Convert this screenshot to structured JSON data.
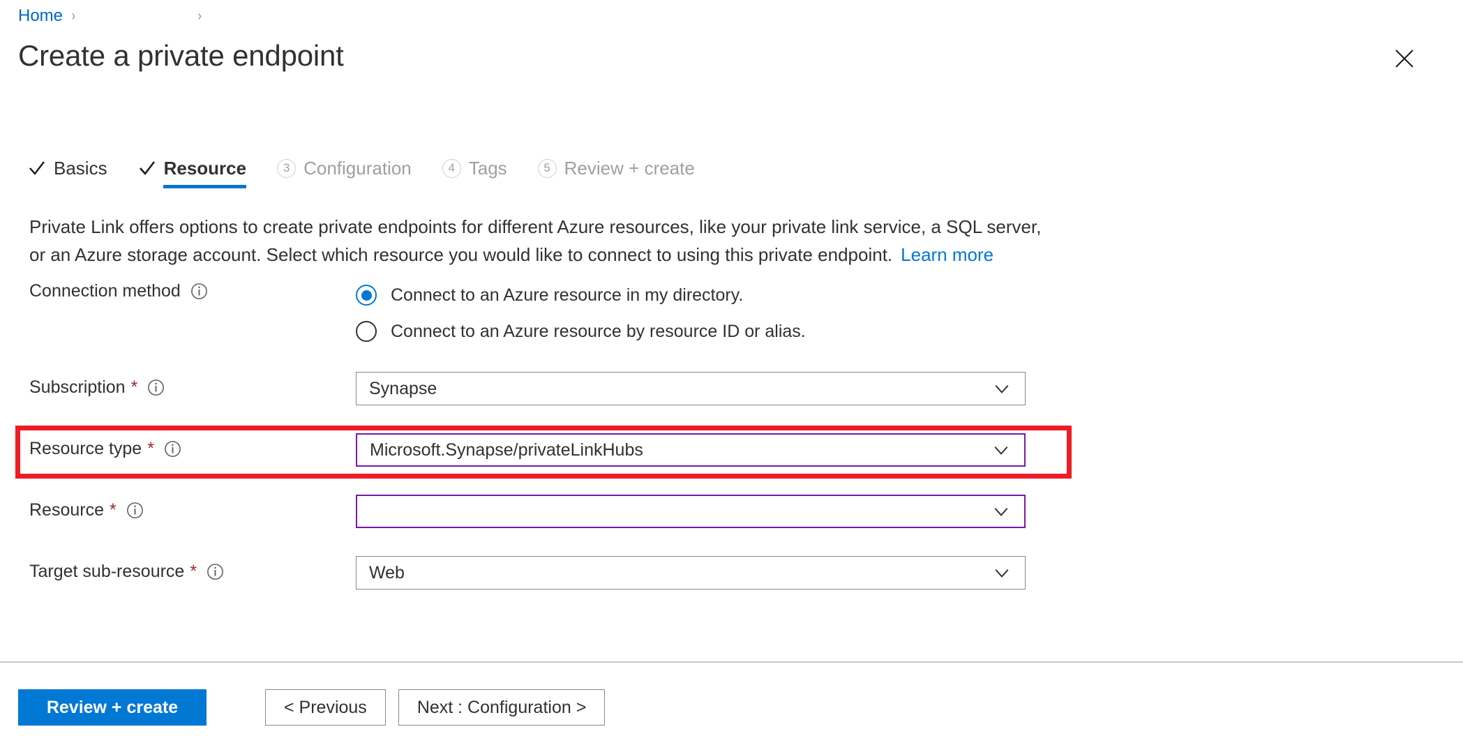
{
  "breadcrumb": {
    "home_label": "Home",
    "separator": "›",
    "second_label": ""
  },
  "header": {
    "title": "Create a private endpoint",
    "close_icon": "close-icon"
  },
  "tabs": [
    {
      "label": "Basics",
      "state": "done",
      "marker": "check"
    },
    {
      "label": "Resource",
      "state": "active",
      "marker": "check"
    },
    {
      "label": "Configuration",
      "state": "upcoming",
      "marker": "3"
    },
    {
      "label": "Tags",
      "state": "upcoming",
      "marker": "4"
    },
    {
      "label": "Review + create",
      "state": "upcoming",
      "marker": "5"
    }
  ],
  "description": {
    "text": "Private Link offers options to create private endpoints for different Azure resources, like your private link service, a SQL server, or an Azure storage account. Select which resource you would like to connect to using this private endpoint.",
    "link_label": "Learn more"
  },
  "form": {
    "connection_method": {
      "label": "Connection method",
      "info_icon": "info-icon",
      "options": [
        {
          "label": "Connect to an Azure resource in my directory.",
          "selected": true
        },
        {
          "label": "Connect to an Azure resource by resource ID or alias.",
          "selected": false
        }
      ]
    },
    "fields": [
      {
        "name": "subscription",
        "label": "Subscription",
        "required": "*",
        "info_icon": "info-icon",
        "value": "Synapse",
        "border": "gray",
        "chevron_icon": "chevron-down-icon"
      },
      {
        "name": "resource_type",
        "label": "Resource type",
        "required": "*",
        "info_icon": "info-icon",
        "value": "Microsoft.Synapse/privateLinkHubs",
        "border": "purple",
        "chevron_icon": "chevron-down-icon",
        "highlighted": true
      },
      {
        "name": "resource",
        "label": "Resource",
        "required": "*",
        "info_icon": "info-icon",
        "value": "",
        "border": "purple",
        "chevron_icon": "chevron-down-icon"
      },
      {
        "name": "target_sub_resource",
        "label": "Target sub-resource",
        "required": "*",
        "info_icon": "info-icon",
        "value": "Web",
        "border": "gray",
        "chevron_icon": "chevron-down-icon"
      }
    ]
  },
  "footer": {
    "review_create_label": "Review + create",
    "previous_label": "< Previous",
    "next_label": "Next : Configuration >"
  },
  "colors": {
    "accent_blue": "#0078d4",
    "link_blue": "#0066cc",
    "annotation_red": "#ee1c25",
    "focus_purple": "#7719aa",
    "required_red": "#a4262c",
    "text_primary": "#323130",
    "text_muted": "#a19f9d"
  }
}
